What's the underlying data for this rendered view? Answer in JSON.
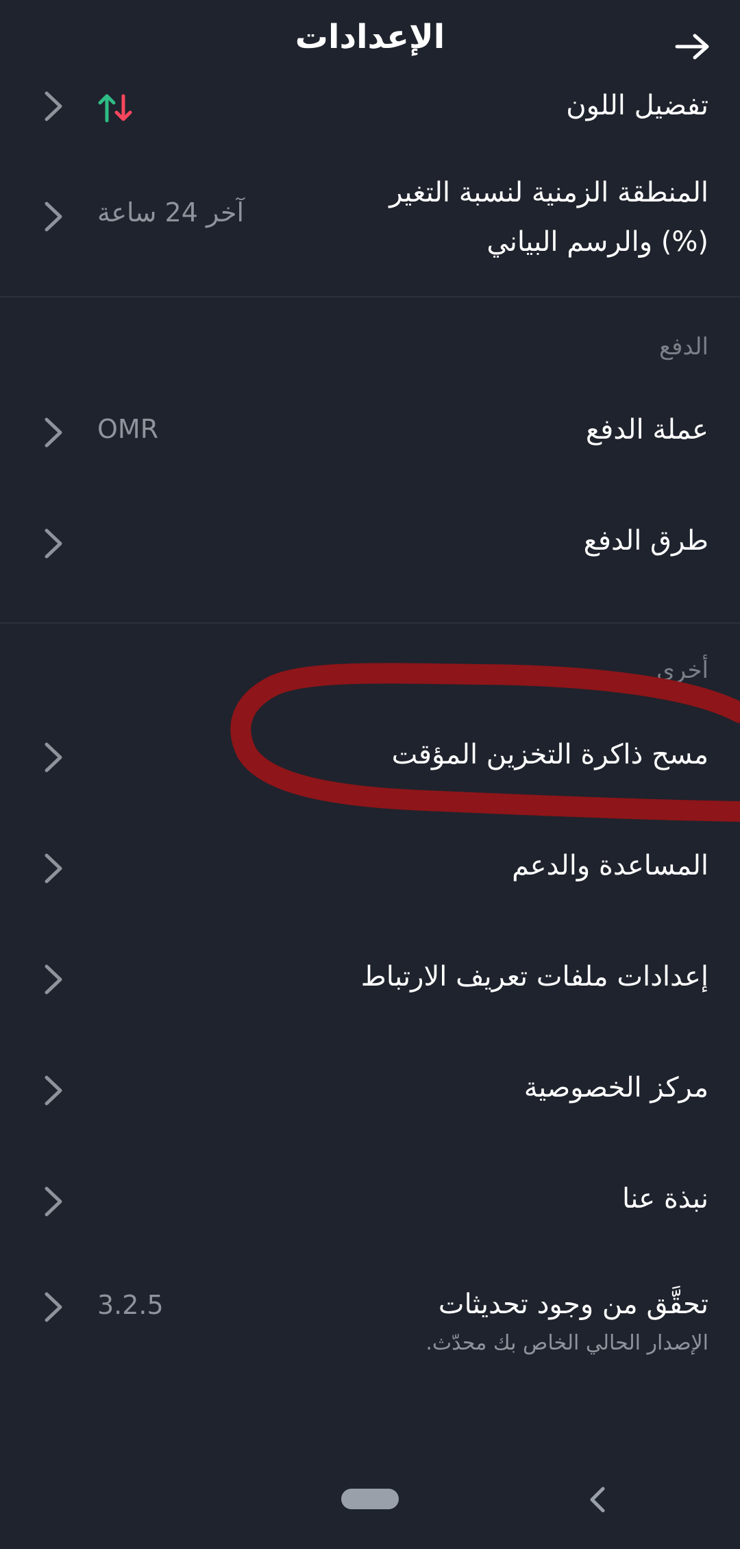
{
  "header": {
    "title": "الإعدادات",
    "back_icon": "arrow-right-icon"
  },
  "rows": {
    "color_pref": {
      "label": "تفضيل اللون",
      "icon": "up-down-arrows-icon",
      "up_color": "#2ebd85",
      "down_color": "#f6465d"
    },
    "timezone": {
      "label_line1": "المنطقة الزمنية لنسبة التغير",
      "label_line2": "(%) والرسم البياني",
      "value": "آخر 24 ساعة"
    },
    "payment_section": "الدفع",
    "pay_currency": {
      "label": "عملة الدفع",
      "value": "OMR"
    },
    "pay_methods": {
      "label": "طرق الدفع"
    },
    "other_section": "أخرى",
    "clear_cache": {
      "label": "مسح ذاكرة التخزين المؤقت"
    },
    "help": {
      "label": "المساعدة والدعم"
    },
    "cookies": {
      "label": "إعدادات ملفات تعريف الارتباط"
    },
    "privacy": {
      "label": "مركز الخصوصية"
    },
    "about": {
      "label": "نبذة عنا"
    },
    "updates": {
      "label": "تحقَّق من وجود تحديثات",
      "subtitle": "الإصدار الحالي الخاص بك محدّث.",
      "value": "3.2.5"
    }
  },
  "annotation_color": "#8e1519",
  "navbar": {
    "home": "home-pill",
    "back": "back-chevron-icon"
  }
}
